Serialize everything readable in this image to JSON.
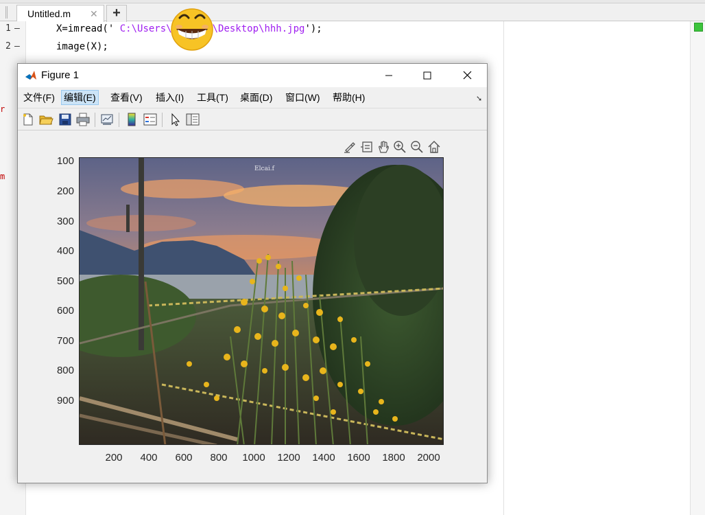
{
  "editor": {
    "tab_label": "Untitled.m",
    "tab_close": "✕",
    "tab_add": "+",
    "line_numbers": [
      "1",
      "2"
    ],
    "line_dash": "—",
    "line1_prefix": "X=imread('",
    "line1_string": " C:\\Users\\       \\Desktop\\hhh.jpg",
    "line1_suffix": "');",
    "line2": "image(X);",
    "status_color": "#3cc43c"
  },
  "figure": {
    "title": "Figure 1",
    "menu": [
      "文件(F)",
      "编辑(E)",
      "查看(V)",
      "插入(I)",
      "工具(T)",
      "桌面(D)",
      "窗口(W)",
      "帮助(H)"
    ],
    "active_menu": "编辑(E)",
    "toolbar_icons": [
      "new-figure-icon",
      "open-file-icon",
      "save-icon",
      "print-icon",
      "link-plot-icon",
      "colorbar-icon",
      "legend-icon",
      "pointer-icon",
      "property-inspector-icon"
    ],
    "axes_toolbar_icons": [
      "brush-icon",
      "data-tips-icon",
      "pan-icon",
      "zoom-in-icon",
      "zoom-out-icon",
      "home-icon"
    ],
    "y_ticks": [
      "100",
      "200",
      "300",
      "400",
      "500",
      "600",
      "700",
      "800",
      "900"
    ],
    "x_ticks": [
      "200",
      "400",
      "600",
      "800",
      "1000",
      "1200",
      "1400",
      "1600",
      "1800",
      "2000"
    ],
    "image_subject": "sunset over sea with rope fence and yellow wildflowers"
  },
  "colors": {
    "accent": "#0072bd",
    "menu_highlight": "#cce4f7",
    "string": "#a020f0"
  }
}
